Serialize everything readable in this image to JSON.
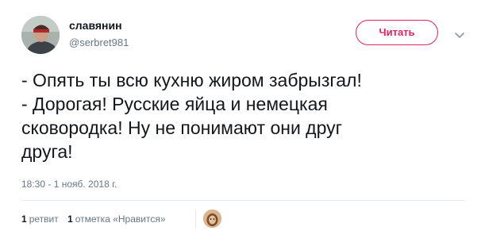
{
  "author": {
    "display_name": "славянин",
    "username": "@serbret981",
    "avatar_icon": "user-avatar-photo"
  },
  "follow_button": {
    "label": "Читать",
    "color": "#e0245e"
  },
  "menu_icon": "chevron-down-icon",
  "tweet": {
    "lines": [
      "- Опять ты всю кухню жиром забрызгал!",
      "- Дорогая! Русские яйца и немецкая",
      "сковородка! Ну не понимают они друг",
      "друга!"
    ],
    "timestamp": "18:30 - 1 нояб. 2018 г."
  },
  "stats": {
    "retweets_count": "1",
    "retweets_label": "ретвит",
    "likes_count": "1",
    "likes_label": "отметка «Нравится»"
  },
  "likers": [
    {
      "avatar_icon": "liker-avatar-photo"
    }
  ]
}
